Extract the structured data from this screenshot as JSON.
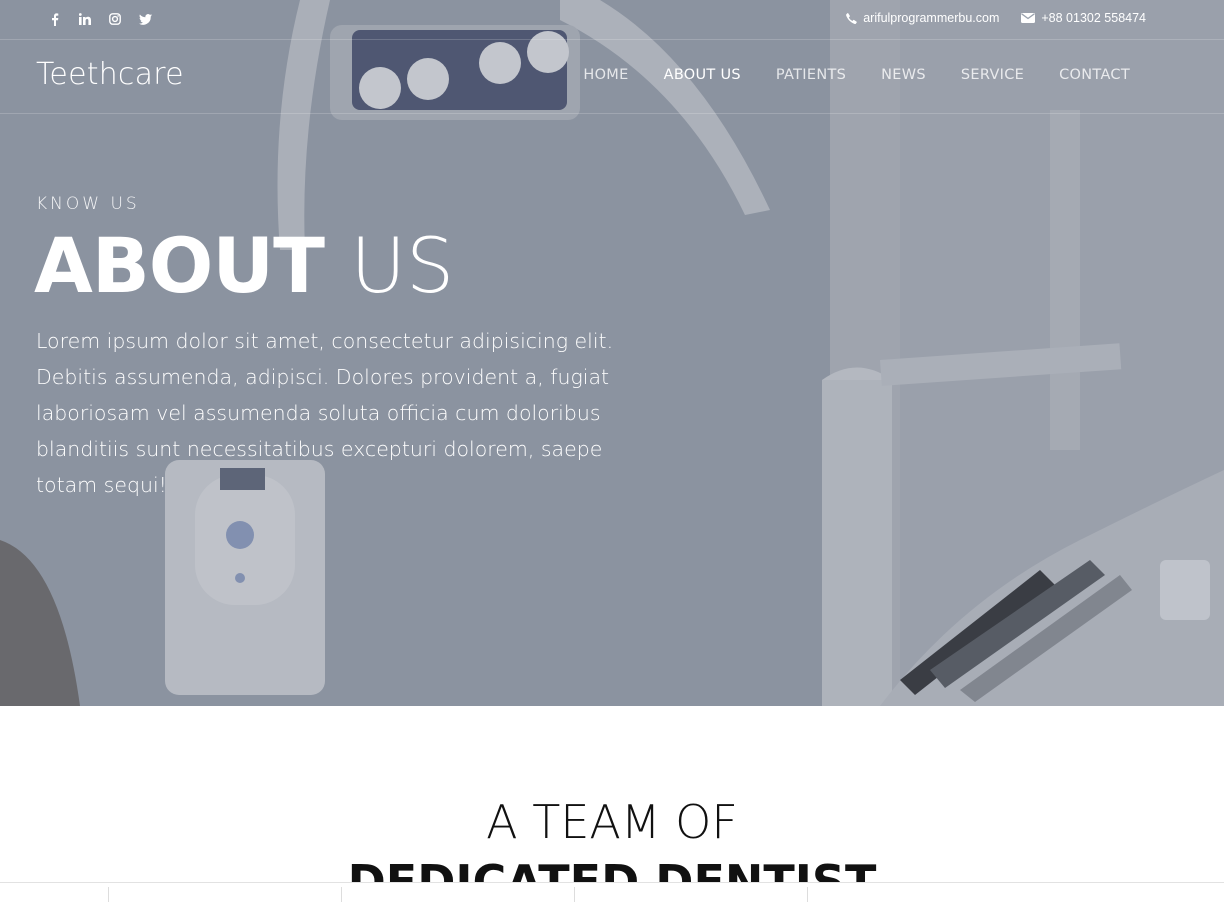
{
  "topbar": {
    "social": [
      {
        "icon": "facebook-icon"
      },
      {
        "icon": "linkedin-icon"
      },
      {
        "icon": "instagram-icon"
      },
      {
        "icon": "twitter-icon"
      }
    ],
    "email": "arifulprogrammerbu.com",
    "phone": "+88 01302 558474"
  },
  "nav": {
    "brand": "Teethcare",
    "items": [
      {
        "label": "HOME",
        "active": false
      },
      {
        "label": "ABOUT US",
        "active": true
      },
      {
        "label": "PATIENTS",
        "active": false
      },
      {
        "label": "NEWS",
        "active": false
      },
      {
        "label": "SERVICE",
        "active": false
      },
      {
        "label": "CONTACT",
        "active": false
      }
    ]
  },
  "hero": {
    "subtitle": "KNOW US",
    "title_bold": "ABOUT",
    "title_light": "US",
    "text": "Lorem ipsum dolor sit amet, consectetur adipisicing elit. Debitis assumenda, adipisci. Dolores provident a, fugiat laboriosam vel assumenda soluta officia cum doloribus blanditiis sunt necessitatibus excepturi dolorem, saepe totam sequi!"
  },
  "team_section": {
    "line1": "A TEAM OF",
    "line2": "DEDICATED DENTIST"
  },
  "colors": {
    "hero_overlay": "#8c95a2",
    "text_on_hero": "#ffffff",
    "heading_dark": "#111111"
  }
}
